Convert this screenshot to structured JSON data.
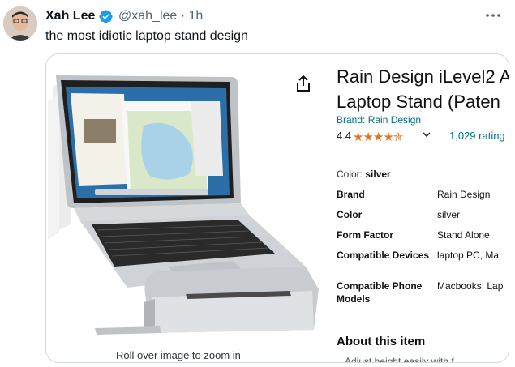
{
  "tweet": {
    "author_name": "Xah Lee",
    "handle": "@xah_lee",
    "separator": "·",
    "time": "1h",
    "text": "the most idiotic laptop stand design",
    "verified_color": "#1d9bf0"
  },
  "product": {
    "title_line1": "Rain Design iLevel2 A",
    "title_line2": "Laptop Stand (Paten",
    "brand": "Brand: Rain Design",
    "rating": "4.4",
    "stars": "★★★★✯",
    "rating_count": "1,029 rating",
    "color_label": "Color:",
    "color_value": "silver",
    "zoom_hint": "Roll over image to zoom in",
    "specs": [
      {
        "key": "Brand",
        "value": "Rain Design"
      },
      {
        "key": "Color",
        "value": "silver"
      },
      {
        "key": "Form Factor",
        "value": "Stand Alone"
      },
      {
        "key": "Compatible Devices",
        "value": "laptop PC, Ma"
      },
      {
        "key": "Compatible Phone Models",
        "value": "Macbooks, Lap"
      }
    ],
    "about_title": "About this item",
    "about_first_line": "Adjust height easily with f",
    "star_color": "#de7921",
    "link_color": "#007185"
  },
  "icons": {
    "more": "more-options-icon",
    "share": "share-icon",
    "verified": "verified-badge-icon",
    "chevron": "chevron-down-icon"
  }
}
